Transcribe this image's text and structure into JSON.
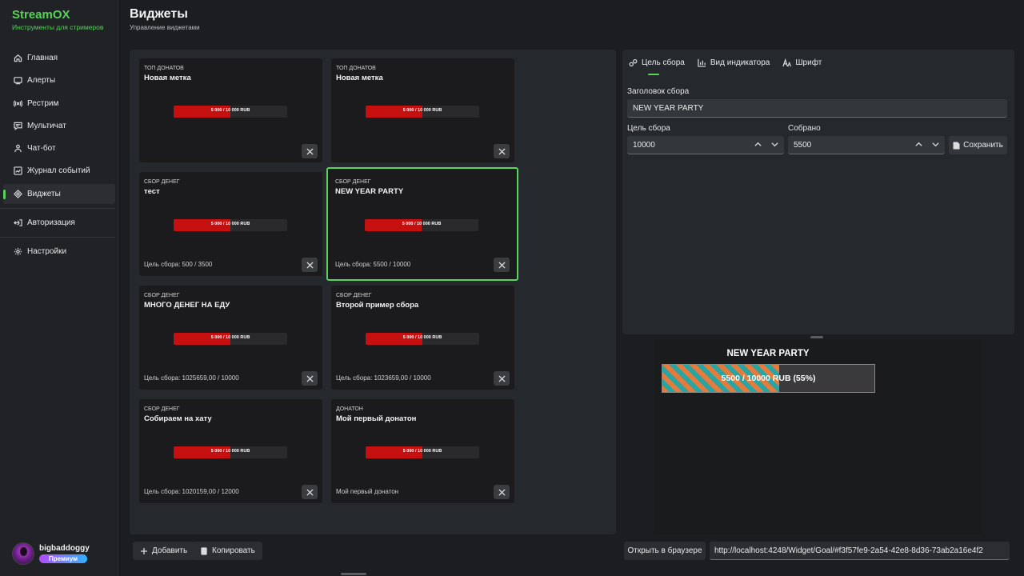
{
  "app": {
    "name": "StreamOX",
    "tagline": "Инструменты для стримеров"
  },
  "nav": {
    "items": [
      {
        "label": "Главная",
        "icon": "home-icon"
      },
      {
        "label": "Алерты",
        "icon": "alerts-icon"
      },
      {
        "label": "Рестрим",
        "icon": "broadcast-icon"
      },
      {
        "label": "Мультичат",
        "icon": "chat-icon"
      },
      {
        "label": "Чат-бот",
        "icon": "bot-icon"
      },
      {
        "label": "Журнал событий",
        "icon": "journal-icon"
      },
      {
        "label": "Виджеты",
        "icon": "widgets-icon",
        "active": true
      },
      {
        "label": "Авторизация",
        "icon": "auth-icon"
      },
      {
        "label": "Настройки",
        "icon": "gear-icon"
      }
    ]
  },
  "user": {
    "name": "bigbaddoggy",
    "badge": "Премиум"
  },
  "header": {
    "title": "Виджеты",
    "subtitle": "Управление виджетами"
  },
  "widgets": [
    {
      "type": "ТОП ДОНАТОВ",
      "title": "Новая метка",
      "bar": "5 000 / 10 000 RUB",
      "progress": 0.5,
      "footer": ""
    },
    {
      "type": "ТОП ДОНАТОВ",
      "title": "Новая метка",
      "bar": "5 000 / 10 000 RUB",
      "progress": 0.5,
      "footer": ""
    },
    {
      "type": "СБОР ДЕНЕГ",
      "title": "тест",
      "bar": "5 000 / 10 000 RUB",
      "progress": 0.5,
      "footer": "Цель сбора: 500 / 3500"
    },
    {
      "type": "СБОР ДЕНЕГ",
      "title": "NEW YEAR PARTY",
      "bar": "5 000 / 10 000 RUB",
      "progress": 0.5,
      "footer": "Цель сбора: 5500 / 10000",
      "selected": true
    },
    {
      "type": "СБОР ДЕНЕГ",
      "title": "МНОГО ДЕНЕГ НА ЕДУ",
      "bar": "5 000 / 10 000 RUB",
      "progress": 0.5,
      "footer": "Цель сбора: 1025659,00 / 10000"
    },
    {
      "type": "СБОР ДЕНЕГ",
      "title": "Второй пример сбора",
      "bar": "5 000 / 10 000 RUB",
      "progress": 0.5,
      "footer": "Цель сбора: 1023659,00 / 10000"
    },
    {
      "type": "СБОР ДЕНЕГ",
      "title": "Собираем на хату",
      "bar": "5 000 / 10 000 RUB",
      "progress": 0.5,
      "footer": "Цель сбора: 1020159,00 / 12000"
    },
    {
      "type": "ДОНАТОН",
      "title": "Мой первый донатон",
      "bar": "5 000 / 10 000 RUB",
      "progress": 0.5,
      "footer": "Мой первый донатон"
    }
  ],
  "toolbar": {
    "add_label": "Добавить",
    "copy_label": "Копировать"
  },
  "editor": {
    "tabs": [
      {
        "label": "Цель сбора",
        "icon": "target-icon",
        "active": true
      },
      {
        "label": "Вид индикатора",
        "icon": "chart-icon"
      },
      {
        "label": "Шрифт",
        "icon": "font-icon"
      }
    ],
    "title_label": "Заголовок сбора",
    "title_value": "NEW YEAR PARTY",
    "goal_label": "Цель сбора",
    "goal_value": "10000",
    "collected_label": "Собрано",
    "collected_value": "5500",
    "save_label": "Сохранить"
  },
  "preview": {
    "title": "NEW YEAR PARTY",
    "bar_text": "5500 / 10000 RUB (55%)",
    "progress": 0.55,
    "colors": {
      "stripe_a": "#e67a3a",
      "stripe_b": "#2aa3a3",
      "track": "#3a3a3c"
    }
  },
  "footer": {
    "open_label": "Открыть в браузере",
    "url": "http://localhost:4248/Widget/Goal/#f3f57fe9-2a54-42e8-8d36-73ab2a16e4f2"
  },
  "colors": {
    "accent": "#58d15a",
    "bar_fill": "#c61010"
  }
}
